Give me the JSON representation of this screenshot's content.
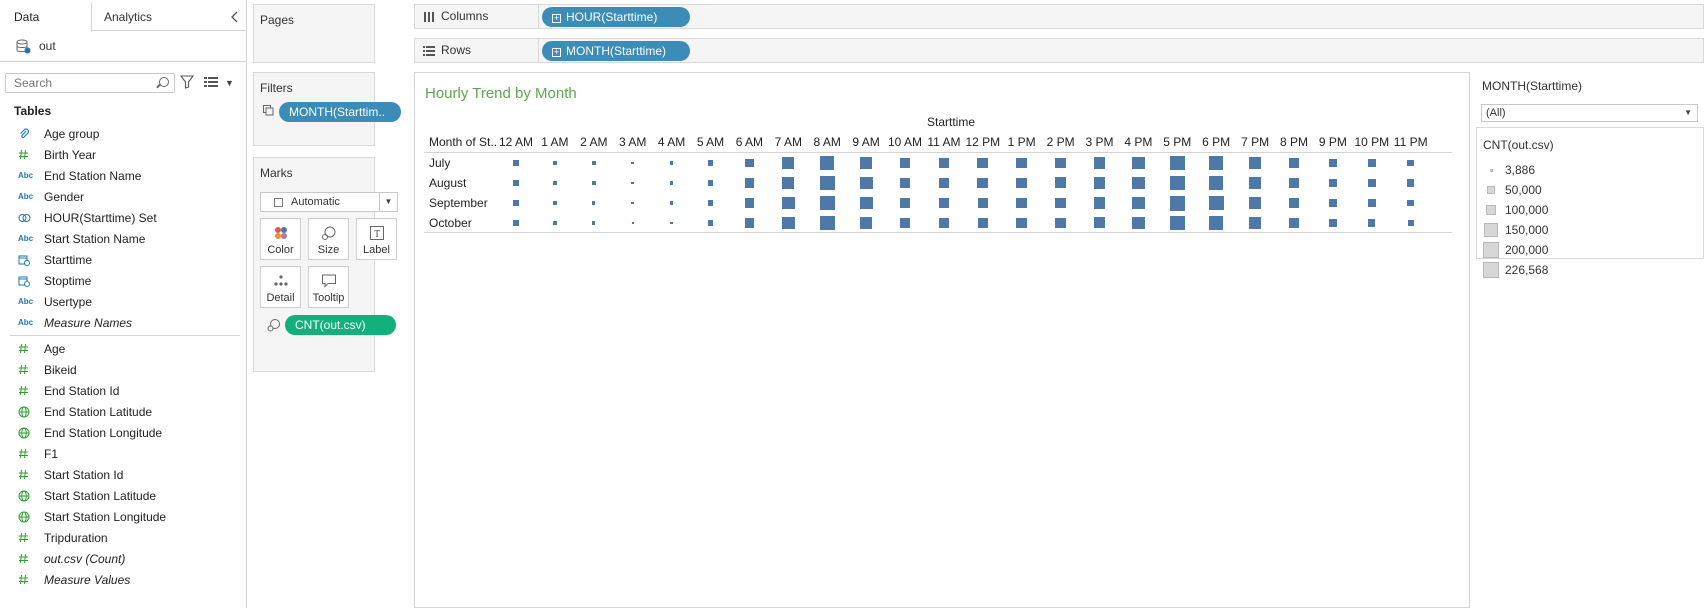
{
  "data_pane": {
    "tabs": [
      {
        "label": "Data"
      },
      {
        "label": "Analytics"
      }
    ],
    "collapse_icon": "chevron-left-icon",
    "datasource": "out",
    "search_placeholder": "Search",
    "tables_title": "Tables",
    "dimensions": [
      {
        "label": "Age group",
        "icon": "paperclip-icon",
        "italic": false
      },
      {
        "label": "Birth Year",
        "icon": "number-icon",
        "italic": false
      },
      {
        "label": "End Station Name",
        "icon": "abc-icon",
        "italic": false
      },
      {
        "label": "Gender",
        "icon": "abc-icon",
        "italic": false
      },
      {
        "label": "HOUR(Starttime) Set",
        "icon": "set-icon",
        "italic": false
      },
      {
        "label": "Start Station Name",
        "icon": "abc-icon",
        "italic": false
      },
      {
        "label": "Starttime",
        "icon": "date-icon",
        "italic": false
      },
      {
        "label": "Stoptime",
        "icon": "date-icon",
        "italic": false
      },
      {
        "label": "Usertype",
        "icon": "abc-icon",
        "italic": false
      },
      {
        "label": "Measure Names",
        "icon": "abc-icon",
        "italic": true
      }
    ],
    "measures": [
      {
        "label": "Age",
        "icon": "number-icon",
        "italic": false
      },
      {
        "label": "Bikeid",
        "icon": "number-icon",
        "italic": false
      },
      {
        "label": "End Station Id",
        "icon": "number-icon",
        "italic": false
      },
      {
        "label": "End Station Latitude",
        "icon": "globe-icon",
        "italic": false
      },
      {
        "label": "End Station Longitude",
        "icon": "globe-icon",
        "italic": false
      },
      {
        "label": "F1",
        "icon": "number-icon",
        "italic": false
      },
      {
        "label": "Start Station Id",
        "icon": "number-icon",
        "italic": false
      },
      {
        "label": "Start Station Latitude",
        "icon": "globe-icon",
        "italic": false
      },
      {
        "label": "Start Station Longitude",
        "icon": "globe-icon",
        "italic": false
      },
      {
        "label": "Tripduration",
        "icon": "number-icon",
        "italic": false
      },
      {
        "label": "out.csv (Count)",
        "icon": "number-icon",
        "italic": true
      },
      {
        "label": "Measure Values",
        "icon": "number-icon",
        "italic": true
      }
    ]
  },
  "pages": {
    "title": "Pages"
  },
  "filters": {
    "title": "Filters",
    "pill": "MONTH(Starttim.."
  },
  "marks": {
    "title": "Marks",
    "type": "Automatic",
    "buttons": [
      {
        "label": "Color",
        "icon": "color-icon"
      },
      {
        "label": "Size",
        "icon": "size-icon"
      },
      {
        "label": "Label",
        "icon": "label-icon"
      },
      {
        "label": "Detail",
        "icon": "detail-icon"
      },
      {
        "label": "Tooltip",
        "icon": "tooltip-icon"
      }
    ],
    "size_pill": "CNT(out.csv)"
  },
  "shelves": {
    "columns": {
      "label": "Columns",
      "pill": "HOUR(Starttime)"
    },
    "rows": {
      "label": "Rows",
      "pill": "MONTH(Starttime)"
    }
  },
  "legends": {
    "filter_title": "MONTH(Starttime)",
    "filter_value": "(All)",
    "size_title": "CNT(out.csv)",
    "size_items": [
      {
        "label": "3,886",
        "value": 3886
      },
      {
        "label": "50,000",
        "value": 50000
      },
      {
        "label": "100,000",
        "value": 100000
      },
      {
        "label": "150,000",
        "value": 150000
      },
      {
        "label": "200,000",
        "value": 200000
      },
      {
        "label": "226,568",
        "value": 226568
      }
    ]
  },
  "chart_data": {
    "type": "heatmap",
    "title": "Hourly Trend by Month",
    "xlabel": "Starttime",
    "row_header": "Month of St..",
    "mark": "square",
    "color": "#4e79a7",
    "size_range": [
      3886,
      226568
    ],
    "categories": [
      "12 AM",
      "1 AM",
      "2 AM",
      "3 AM",
      "4 AM",
      "5 AM",
      "6 AM",
      "7 AM",
      "8 AM",
      "9 AM",
      "10 AM",
      "11 AM",
      "12 PM",
      "1 PM",
      "2 PM",
      "3 PM",
      "4 PM",
      "5 PM",
      "6 PM",
      "7 PM",
      "8 PM",
      "9 PM",
      "10 PM",
      "11 PM"
    ],
    "series": [
      {
        "name": "July",
        "values": [
          40000,
          22000,
          13000,
          9000,
          11000,
          32000,
          80000,
          150000,
          210000,
          165000,
          110000,
          105000,
          115000,
          118000,
          120000,
          130000,
          165000,
          215000,
          205000,
          155000,
          105000,
          75000,
          60000,
          48000
        ]
      },
      {
        "name": "August",
        "values": [
          42000,
          23000,
          13000,
          9000,
          11000,
          33000,
          82000,
          152000,
          215000,
          168000,
          112000,
          108000,
          118000,
          120000,
          122000,
          133000,
          168000,
          220000,
          210000,
          158000,
          108000,
          77000,
          62000,
          50000
        ]
      },
      {
        "name": "September",
        "values": [
          38000,
          20000,
          11000,
          8000,
          10000,
          33000,
          88000,
          160000,
          222000,
          170000,
          110000,
          102000,
          112000,
          114000,
          117000,
          128000,
          168000,
          226568,
          215000,
          155000,
          100000,
          72000,
          56000,
          44000
        ]
      },
      {
        "name": "October",
        "values": [
          33000,
          17000,
          9500,
          3886,
          9000,
          30000,
          85000,
          158000,
          220000,
          165000,
          104000,
          96000,
          106000,
          109000,
          111000,
          122000,
          162000,
          222000,
          208000,
          148000,
          94000,
          66000,
          51000,
          39000
        ]
      }
    ]
  }
}
